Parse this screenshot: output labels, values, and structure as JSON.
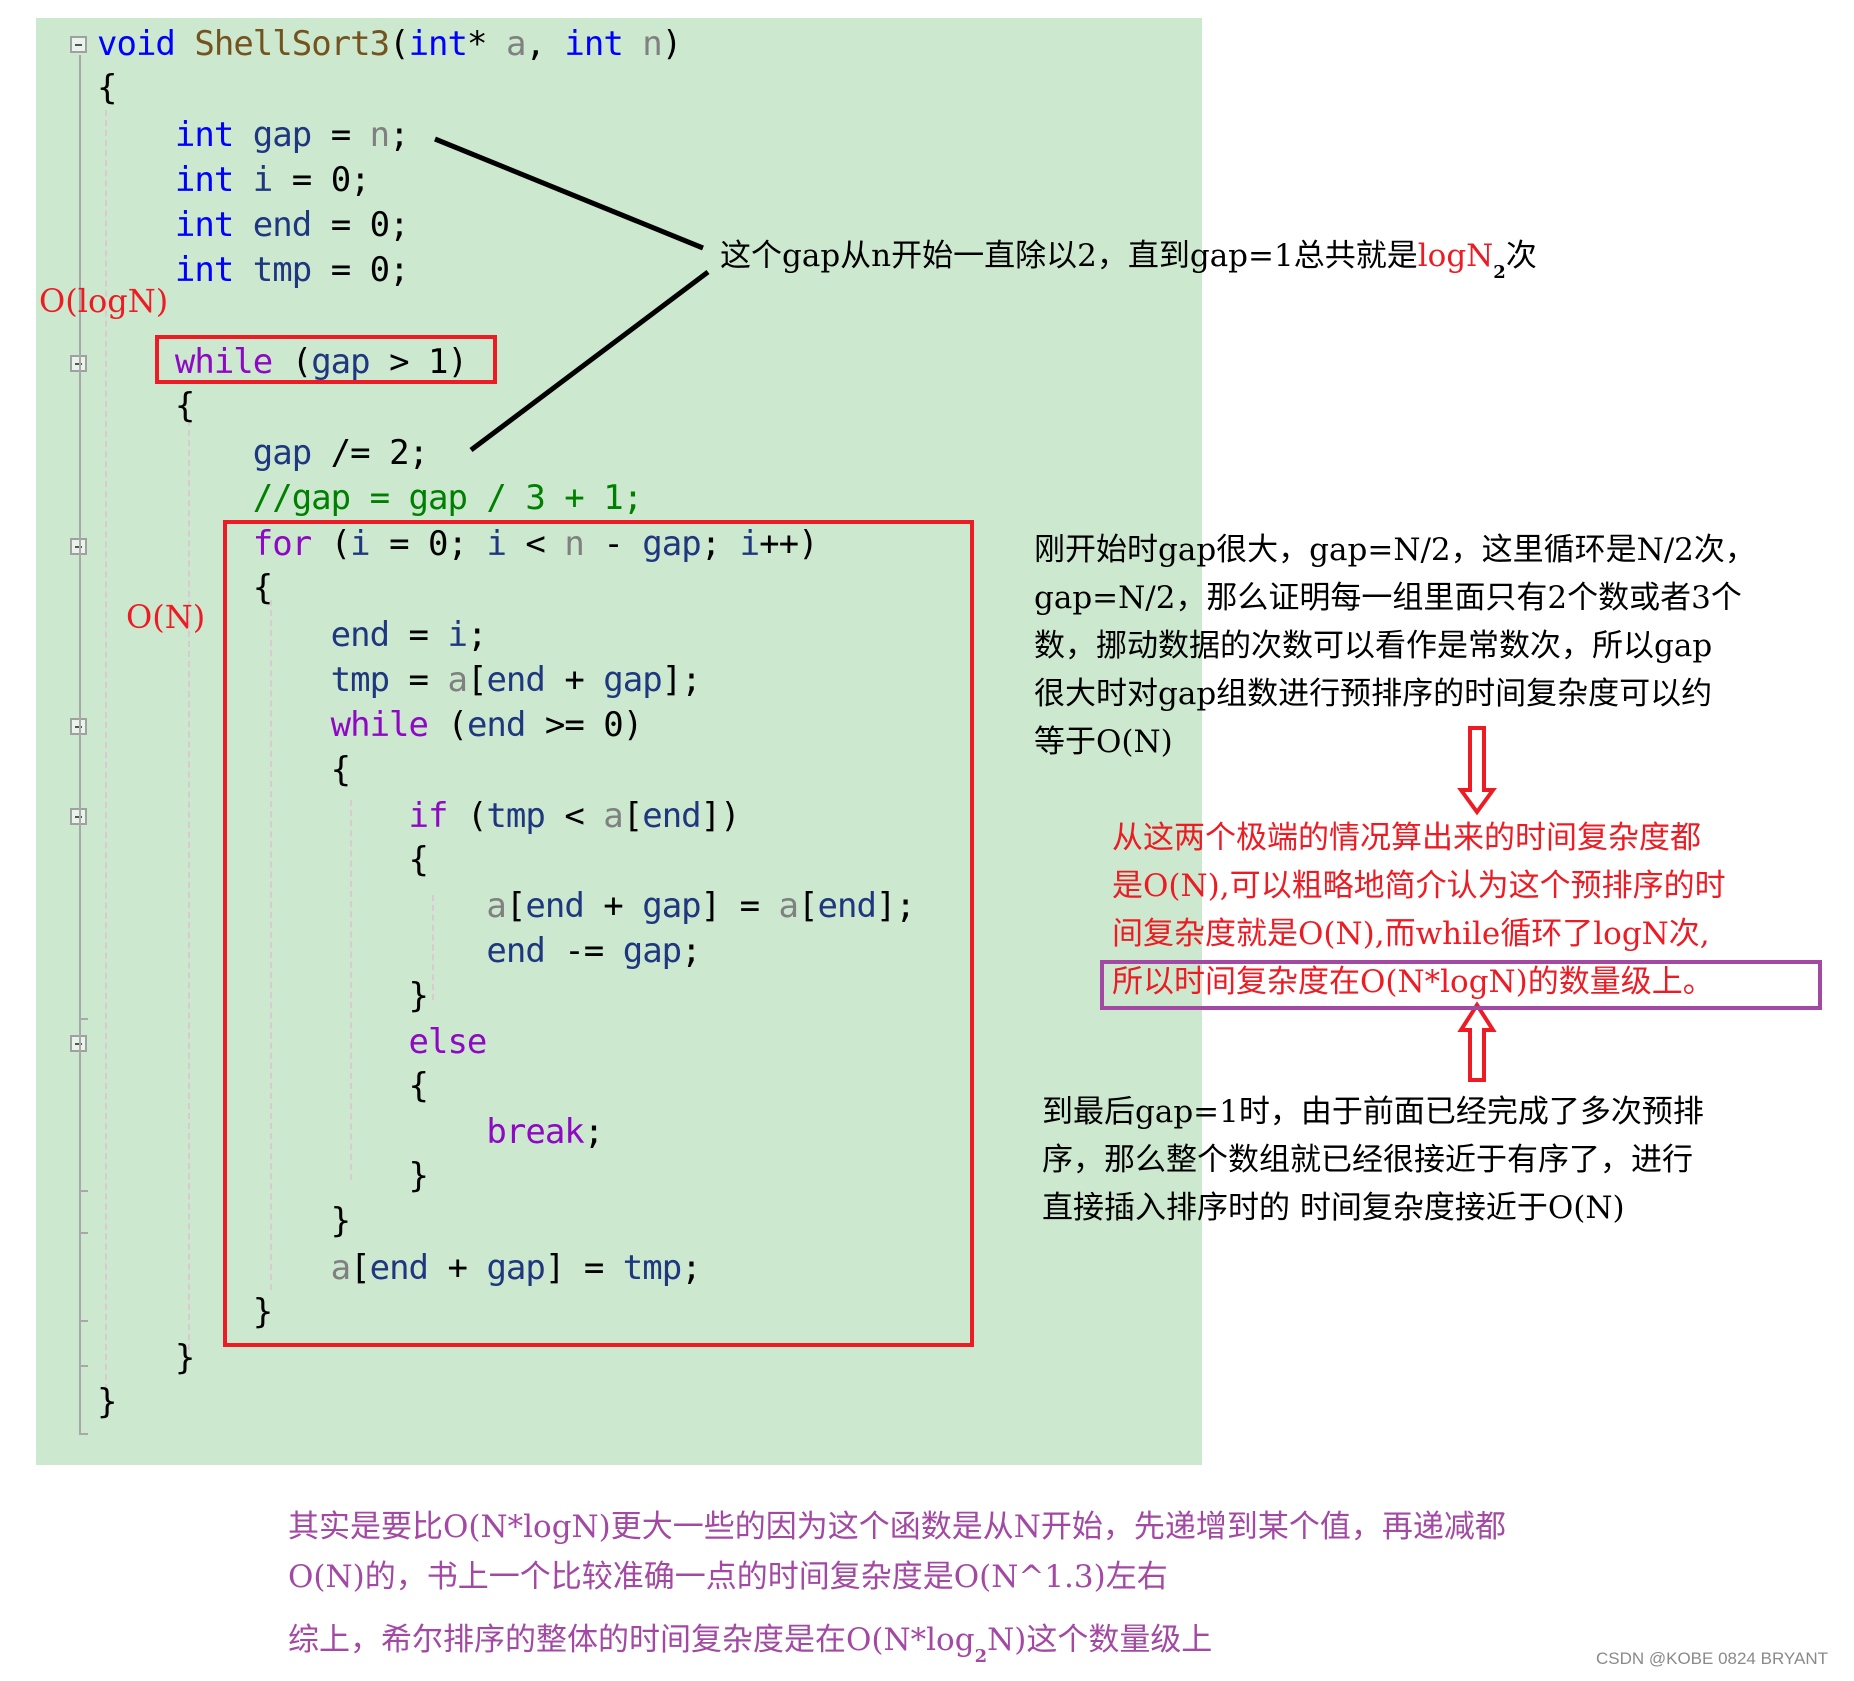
{
  "code": {
    "language": "C",
    "lines": [
      {
        "tokens": [
          [
            "kw",
            "void"
          ],
          [
            "",
            "  "
          ],
          [
            "fn",
            "ShellSort3"
          ],
          [
            "",
            "("
          ],
          [
            "kw",
            "int"
          ],
          [
            "",
            "* "
          ],
          [
            "prm",
            "a"
          ],
          [
            "",
            ", "
          ],
          [
            "kw",
            "int"
          ],
          [
            "",
            " "
          ],
          [
            "prm",
            "n"
          ],
          [
            "",
            ")"
          ]
        ]
      },
      {
        "tokens": [
          [
            "",
            "{"
          ]
        ]
      },
      {
        "tokens": [
          [
            "",
            "    "
          ],
          [
            "kw",
            "int"
          ],
          [
            "",
            " "
          ],
          [
            "var",
            "gap"
          ],
          [
            "",
            " = "
          ],
          [
            "prm",
            "n"
          ],
          [
            "",
            ";"
          ]
        ]
      },
      {
        "tokens": [
          [
            "",
            "    "
          ],
          [
            "kw",
            "int"
          ],
          [
            "",
            " "
          ],
          [
            "var",
            "i"
          ],
          [
            "",
            " = 0;"
          ]
        ]
      },
      {
        "tokens": [
          [
            "",
            "    "
          ],
          [
            "kw",
            "int"
          ],
          [
            "",
            " "
          ],
          [
            "var",
            "end"
          ],
          [
            "",
            " = 0;"
          ]
        ]
      },
      {
        "tokens": [
          [
            "",
            "    "
          ],
          [
            "kw",
            "int"
          ],
          [
            "",
            " "
          ],
          [
            "var",
            "tmp"
          ],
          [
            "",
            " = 0;"
          ]
        ]
      },
      {
        "tokens": []
      },
      {
        "tokens": [
          [
            "",
            "    "
          ],
          [
            "ctl",
            "while"
          ],
          [
            "",
            " ("
          ],
          [
            "var",
            "gap"
          ],
          [
            "",
            " > 1)"
          ]
        ]
      },
      {
        "tokens": [
          [
            "",
            "    {"
          ]
        ]
      },
      {
        "tokens": [
          [
            "",
            "        "
          ],
          [
            "var",
            "gap"
          ],
          [
            "",
            " /= 2;"
          ]
        ]
      },
      {
        "tokens": [
          [
            "",
            "        "
          ],
          [
            "cmt",
            "//gap = gap / 3 + 1;"
          ]
        ]
      },
      {
        "tokens": [
          [
            "",
            "        "
          ],
          [
            "ctl",
            "for"
          ],
          [
            "",
            " ("
          ],
          [
            "var",
            "i"
          ],
          [
            "",
            " = 0; "
          ],
          [
            "var",
            "i"
          ],
          [
            "",
            " < "
          ],
          [
            "prm",
            "n"
          ],
          [
            "",
            " - "
          ],
          [
            "var",
            "gap"
          ],
          [
            "",
            "; "
          ],
          [
            "var",
            "i"
          ],
          [
            "",
            "++)"
          ]
        ]
      },
      {
        "tokens": [
          [
            "",
            "        {"
          ]
        ]
      },
      {
        "tokens": [
          [
            "",
            "            "
          ],
          [
            "var",
            "end"
          ],
          [
            "",
            " = "
          ],
          [
            "var",
            "i"
          ],
          [
            "",
            ";"
          ]
        ]
      },
      {
        "tokens": [
          [
            "",
            "            "
          ],
          [
            "var",
            "tmp"
          ],
          [
            "",
            " = "
          ],
          [
            "prm",
            "a"
          ],
          [
            "",
            "["
          ],
          [
            "var",
            "end"
          ],
          [
            "",
            " + "
          ],
          [
            "var",
            "gap"
          ],
          [
            "",
            "];"
          ]
        ]
      },
      {
        "tokens": [
          [
            "",
            "            "
          ],
          [
            "ctl",
            "while"
          ],
          [
            "",
            " ("
          ],
          [
            "var",
            "end"
          ],
          [
            "",
            " >= 0)"
          ]
        ]
      },
      {
        "tokens": [
          [
            "",
            "            {"
          ]
        ]
      },
      {
        "tokens": [
          [
            "",
            "                "
          ],
          [
            "ctl",
            "if"
          ],
          [
            "",
            " ("
          ],
          [
            "var",
            "tmp"
          ],
          [
            "",
            " < "
          ],
          [
            "prm",
            "a"
          ],
          [
            "",
            "["
          ],
          [
            "var",
            "end"
          ],
          [
            "",
            "])"
          ]
        ]
      },
      {
        "tokens": [
          [
            "",
            "                {"
          ]
        ]
      },
      {
        "tokens": [
          [
            "",
            "                    "
          ],
          [
            "prm",
            "a"
          ],
          [
            "",
            "["
          ],
          [
            "var",
            "end"
          ],
          [
            "",
            " + "
          ],
          [
            "var",
            "gap"
          ],
          [
            "",
            "] = "
          ],
          [
            "prm",
            "a"
          ],
          [
            "",
            "["
          ],
          [
            "var",
            "end"
          ],
          [
            "",
            "];"
          ]
        ]
      },
      {
        "tokens": [
          [
            "",
            "                    "
          ],
          [
            "var",
            "end"
          ],
          [
            "",
            " -= "
          ],
          [
            "var",
            "gap"
          ],
          [
            "",
            ";"
          ]
        ]
      },
      {
        "tokens": [
          [
            "",
            "                }"
          ]
        ]
      },
      {
        "tokens": [
          [
            "",
            "                "
          ],
          [
            "ctl",
            "else"
          ]
        ]
      },
      {
        "tokens": [
          [
            "",
            "                {"
          ]
        ]
      },
      {
        "tokens": [
          [
            "",
            "                    "
          ],
          [
            "ctl",
            "break"
          ],
          [
            "",
            ";"
          ]
        ]
      },
      {
        "tokens": [
          [
            "",
            "                }"
          ]
        ]
      },
      {
        "tokens": [
          [
            "",
            "            }"
          ]
        ]
      },
      {
        "tokens": [
          [
            "",
            "            "
          ],
          [
            "prm",
            "a"
          ],
          [
            "",
            "["
          ],
          [
            "var",
            "end"
          ],
          [
            "",
            " + "
          ],
          [
            "var",
            "gap"
          ],
          [
            "",
            "] = "
          ],
          [
            "var",
            "tmp"
          ],
          [
            "",
            ";"
          ]
        ]
      },
      {
        "tokens": [
          [
            "",
            "        }"
          ]
        ]
      },
      {
        "tokens": [
          [
            "",
            "    }"
          ]
        ]
      },
      {
        "tokens": [
          [
            "",
            "}"
          ]
        ]
      }
    ]
  },
  "labels": {
    "outer_complexity": "O(logN)",
    "inner_complexity": "O(N)"
  },
  "notes": {
    "gap_note_prefix": "这个gap从n开始一直除以2，直到gap=1总共就是",
    "gap_note_highlight": "logN",
    "gap_note_sub": "2",
    "gap_note_suffix": "次",
    "large_gap_lines": [
      "刚开始时gap很大，gap=N/2，这里循环是N/2次，",
      "gap=N/2，那么证明每一组里面只有2个数或者3个",
      "数，挪动数据的次数可以看作是常数次，所以gap",
      "很大时对gap组数进行预排序的时间复杂度可以约",
      "等于O(N)"
    ],
    "conclusion_lines": [
      "从这两个极端的情况算出来的时间复杂度都",
      "是O(N),可以粗略地简介认为这个预排序的时",
      "间复杂度就是O(N),而while循环了logN次,"
    ],
    "conclusion_boxed": "所以时间复杂度在O(N*logN)的数量级上。",
    "small_gap_lines": [
      "到最后gap=1时，由于前面已经完成了多次预排",
      "序，那么整个数组就已经很接近于有序了，进行",
      "直接插入排序时的 时间复杂度接近于O(N)"
    ],
    "bottom_lines": [
      "其实是要比O(N*logN)更大一些的因为这个函数是从N开始，先递增到某个值，再递减都",
      "O(N)的，书上一个比较准确一点的时间复杂度是O(N^1.3)左右"
    ],
    "summary_prefix": "综上，希尔排序的整体的时间复杂度是在O(N*log",
    "summary_sub": "2",
    "summary_suffix": "N)这个数量级上"
  },
  "colors": {
    "code_background": "#cce8cf",
    "highlight_red": "#ed1c24",
    "highlight_purple": "#a349a4"
  },
  "watermark": "CSDN @KOBE 0824 BRYANT"
}
